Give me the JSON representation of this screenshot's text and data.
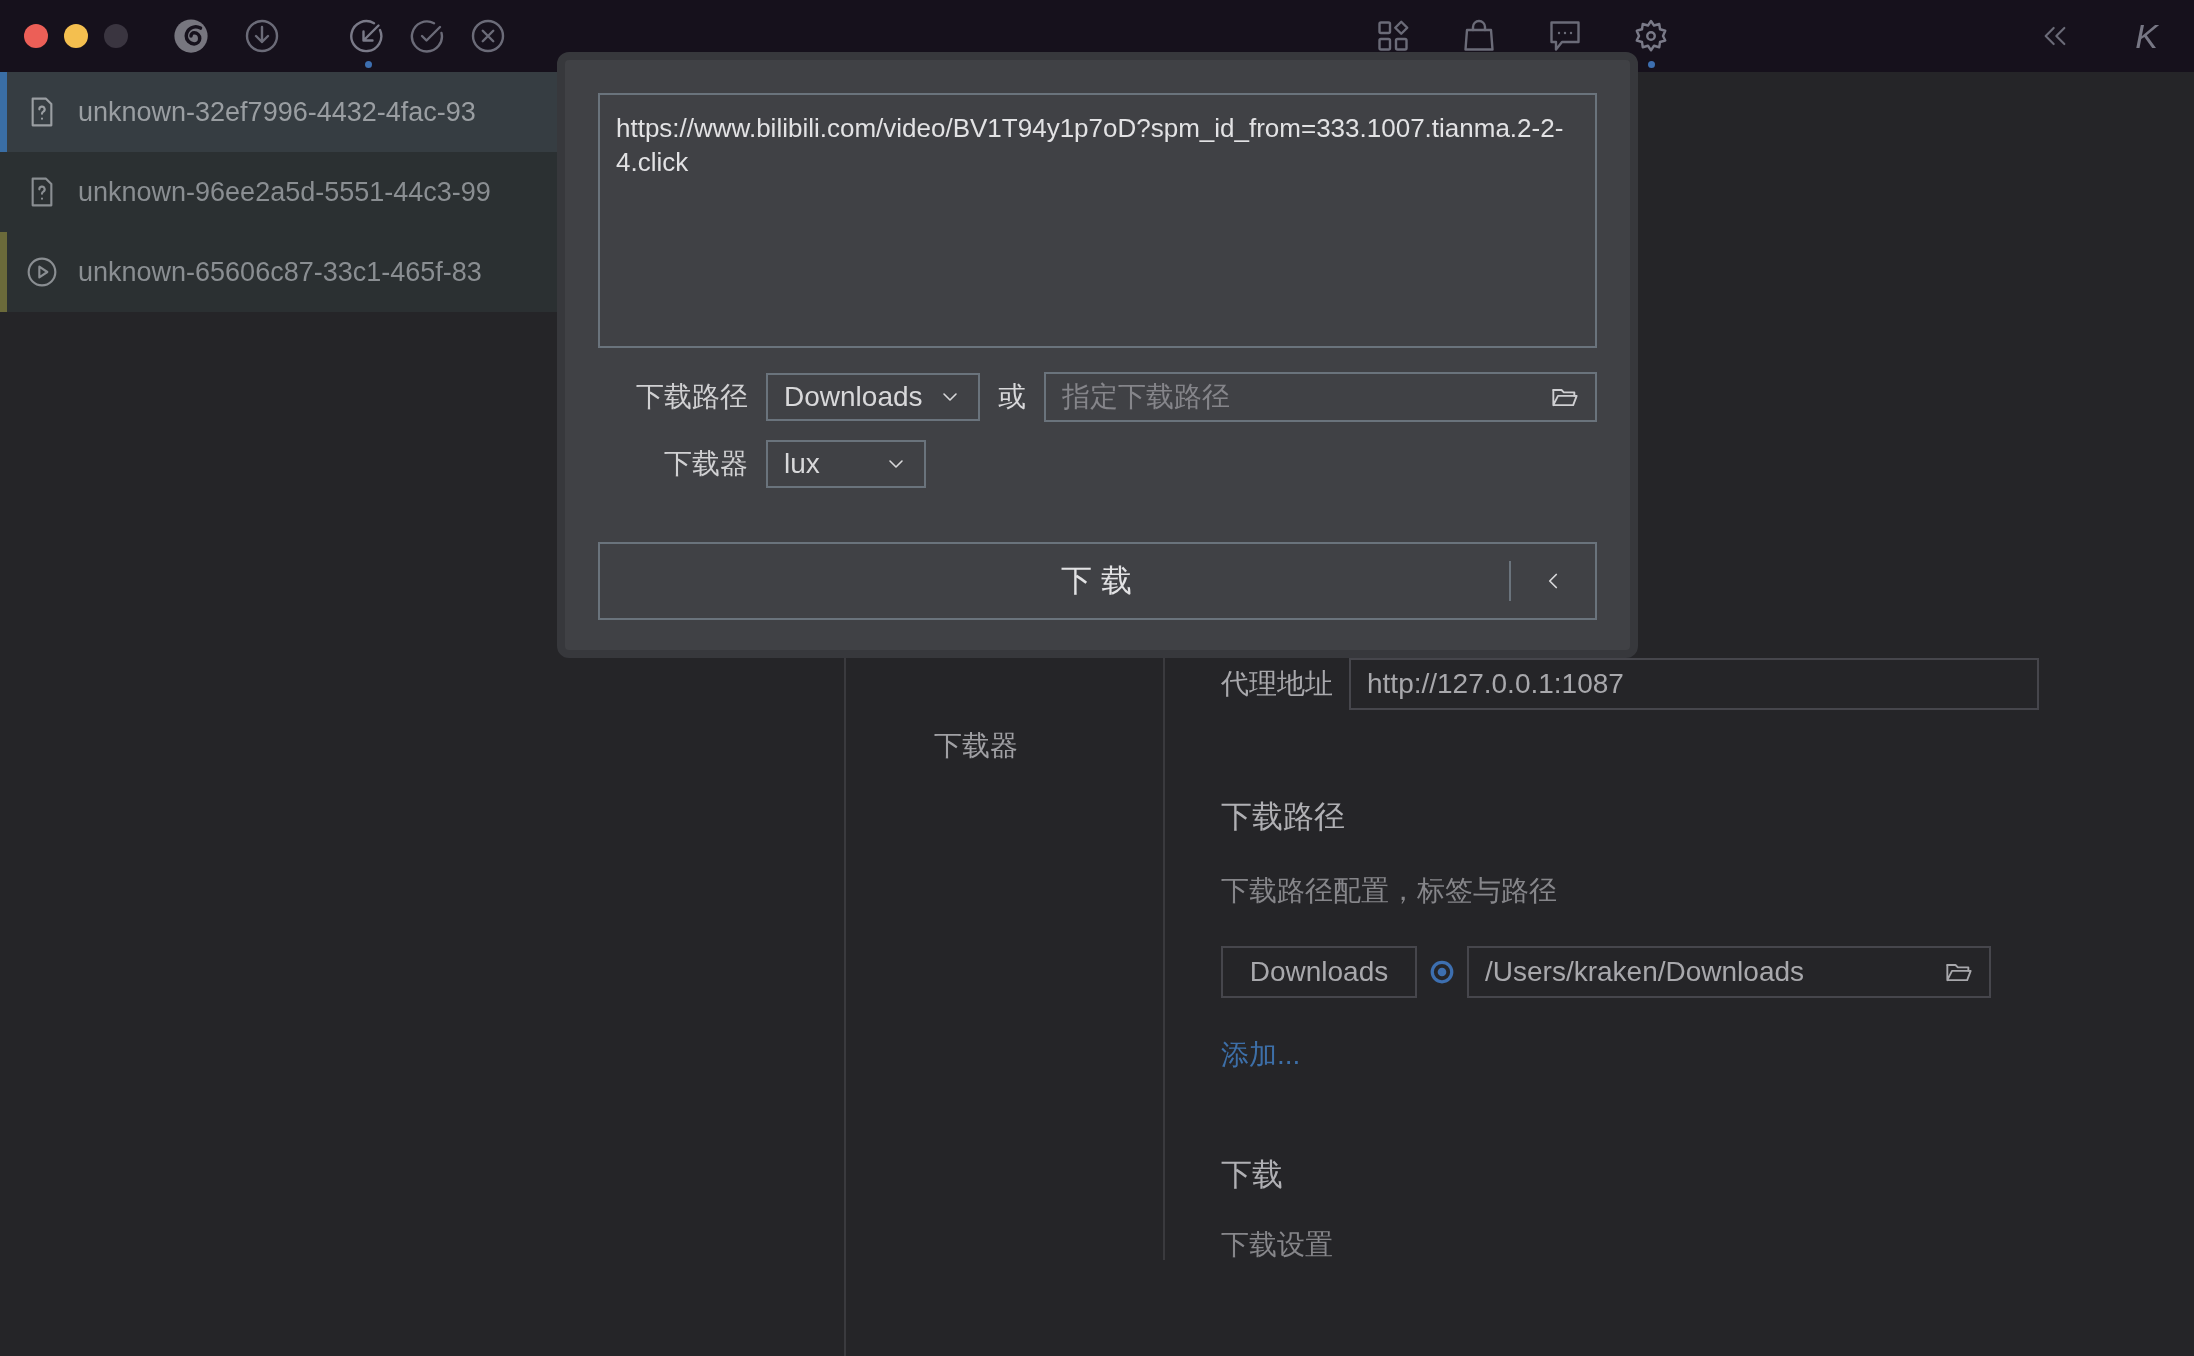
{
  "toolbar": {
    "left_icons": [
      {
        "kind": "download",
        "selected": false
      },
      {
        "kind": "import",
        "selected": true
      },
      {
        "kind": "done",
        "selected": false
      },
      {
        "kind": "failed",
        "selected": false
      }
    ],
    "right_icons": [
      {
        "kind": "apps",
        "selected": false
      },
      {
        "kind": "store",
        "selected": false
      },
      {
        "kind": "chat",
        "selected": false
      },
      {
        "kind": "settings",
        "selected": true
      }
    ],
    "profile_letter": "K"
  },
  "tasks": [
    {
      "kind": "unknown",
      "name": "unknown-32ef7996-4432-4fac-93",
      "selected": true,
      "color": "#3a6ea5"
    },
    {
      "kind": "unknown",
      "name": "unknown-96ee2a5d-5551-44c3-99",
      "selected": false
    },
    {
      "kind": "video",
      "name": "unknown-65606c87-33c1-465f-83",
      "selected": false,
      "color": "#6b6a3a"
    }
  ],
  "dialog": {
    "url": "https://www.bilibili.com/video/BV1T94y1p7oD?spm_id_from=333.1007.tianma.2-2-4.click",
    "path_label": "下载路径",
    "path_select": "Downloads",
    "or": "或",
    "path_placeholder": "指定下载路径",
    "downloader_label": "下载器",
    "downloader_select": "lux",
    "download_button": "下 载"
  },
  "settings": {
    "nav": [
      "下载器"
    ],
    "proxy_label": "代理地址",
    "proxy_value": "http://127.0.0.1:1087",
    "path_section": {
      "title": "下载路径",
      "description": "下载路径配置，标签与路径",
      "entries": [
        {
          "label": "Downloads",
          "selected": true,
          "path": "/Users/kraken/Downloads"
        }
      ],
      "add_link": "添加..."
    },
    "download_section": {
      "title": "下载",
      "description": "下载设置"
    }
  }
}
